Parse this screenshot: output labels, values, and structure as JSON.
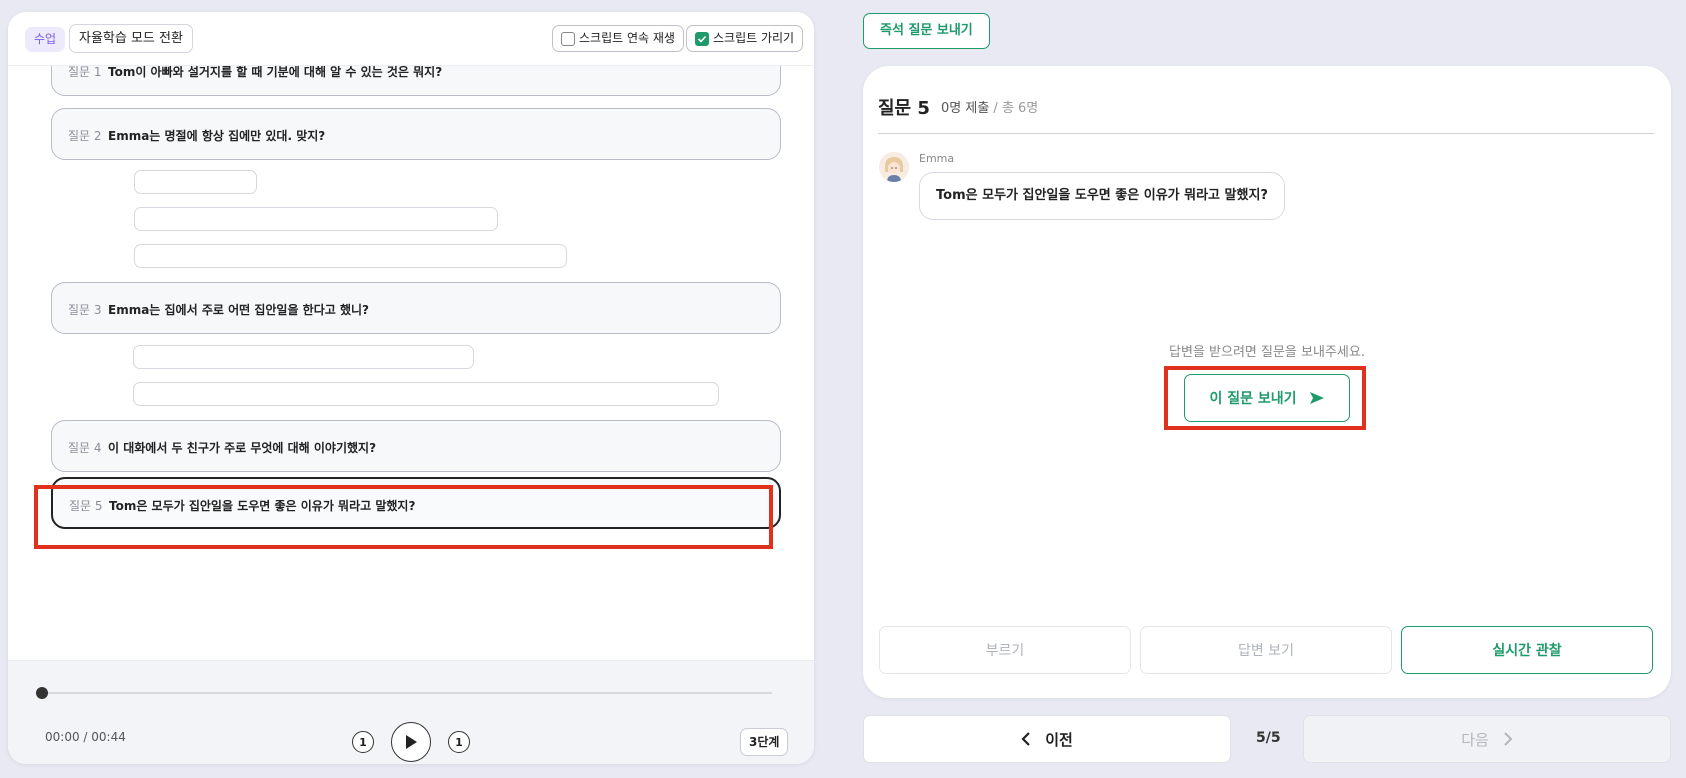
{
  "left": {
    "class_badge": "수업",
    "mode_button": "자율학습 모드 전환",
    "chk_continuous": "스크립트 연속 재생",
    "chk_hide": "스크립트 가리기",
    "questions": [
      {
        "num": "질문 1",
        "text": "Tom이 아빠와 설거지를 할 때 기분에 대해 알 수 있는 것은 뭐지?"
      },
      {
        "num": "질문 2",
        "text": "Emma는 명절에 항상 집에만 있대. 맞지?"
      },
      {
        "num": "질문 3",
        "text": "Emma는 집에서 주로 어떤 집안일을 한다고 했니?"
      },
      {
        "num": "질문 4",
        "text": "이 대화에서 두 친구가 주로 무엇에 대해 이야기했지?"
      },
      {
        "num": "질문 5",
        "text": "Tom은 모두가 집안일을 도우면 좋은 이유가 뭐라고 말했지?"
      }
    ],
    "player": {
      "time": "00:00 / 00:44",
      "rewind_label": "1",
      "forward_label": "1",
      "level": "3단계",
      "progress": 0
    }
  },
  "right": {
    "send_now": "즉석 질문 보내기",
    "title": "질문 5",
    "submitted": "0명 제출",
    "total": " / 총 6명",
    "speaker": "Emma",
    "bubble": "Tom은 모두가 집안일을 도우면 좋은 이유가 뭐라고 말했지?",
    "hint": "답변을 받으려면 질문을 보내주세요.",
    "send_question": "이 질문 보내기",
    "actions": [
      "부르기",
      "답변 보기",
      "실시간 관찰"
    ],
    "prev": "이전",
    "page": "5/5",
    "next": "다음"
  },
  "colors": {
    "accent_green": "#1f9a6a",
    "highlight_red": "#e0301e",
    "class_purple": "#7b5de0"
  }
}
